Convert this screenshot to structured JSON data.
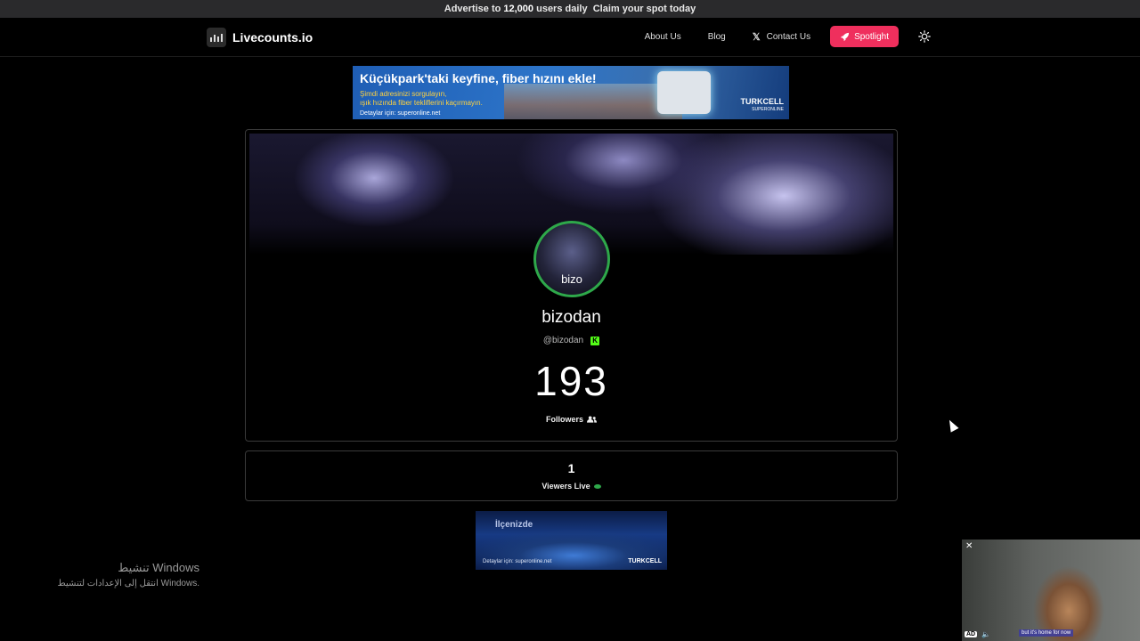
{
  "topbar": {
    "text_prefix": "Advertise to ",
    "text_strong": "12,000",
    "text_suffix": " users daily",
    "cta": "Claim your spot today"
  },
  "header": {
    "logo_text": "Livecounts.io",
    "nav": {
      "about": "About Us",
      "blog": "Blog",
      "contact": "Contact Us",
      "spotlight": "Spotlight"
    }
  },
  "ad_top": {
    "headline": "Küçükpark'taki keyfine, fiber hızını ekle!",
    "line1": "Şimdi adresinizi sorgulayın,",
    "line2": "ışık hızında fiber tekliflerini kaçırmayın.",
    "line3": "Detaylar için: superonline.net",
    "brand": "TURKCELL",
    "brand_sub": "SUPERONLINE"
  },
  "profile": {
    "avatar_text": "bizo",
    "name": "bizodan",
    "handle": "@bizodan",
    "platform_icon": "K",
    "count": "193",
    "count_label": "Followers"
  },
  "viewers": {
    "count": "1",
    "label": "Viewers Live"
  },
  "ad_bottom": {
    "title": "İlçenizde",
    "small": "Detaylar için: superonline.net",
    "brand": "TURKCELL"
  },
  "watermark": {
    "line1": "تنشيط Windows",
    "line2": "انتقل إلى الإعدادات لتنشيط Windows."
  },
  "video_ad": {
    "badge": "AD",
    "caption": "but it's home for now"
  },
  "colors": {
    "accent": "#ef2f5d",
    "avatar_ring": "#2ea84a",
    "kick_green": "#53fc18"
  }
}
